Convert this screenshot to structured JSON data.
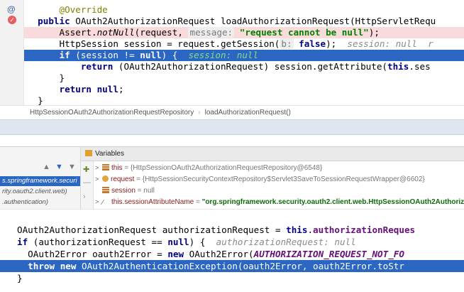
{
  "editor_top": {
    "line1": {
      "annotation": "@Override"
    },
    "line2": {
      "kw1": "public",
      "text": " OAuth2AuthorizationRequest loadAuthorizationRequest(HttpServletRequ"
    },
    "line3": {
      "call": "Assert.",
      "method": "notNull",
      "open": "(request, ",
      "hint": "message:",
      "string": "\"request cannot be null\"",
      "close": ");"
    },
    "line4": {
      "text": "HttpSession session = request.getSession(",
      "hint": "b:",
      "kw": "false",
      "close": ");",
      "inline": "  session: null  r"
    },
    "line5": {
      "kw1": "if",
      "mid": " (session != ",
      "kw2": "null",
      "close": ") {",
      "inline": "  session: null"
    },
    "line6": {
      "kw": "return",
      "text": " (OAuth2AuthorizationRequest) session.getAttribute(",
      "kw2": "this",
      "tail": ".ses"
    },
    "line7": {
      "text": "}"
    },
    "line8": {
      "kw": "return",
      "mid": " ",
      "kw2": "null",
      "close": ";"
    },
    "line9": {
      "text": "}"
    }
  },
  "breadcrumb": {
    "class_name": "HttpSessionOAuth2AuthorizationRequestRepository",
    "method_name": "loadAuthorizationRequest()",
    "sep": "›"
  },
  "debugger": {
    "variables_title": "Variables",
    "frames": [
      "s.springframework.securi",
      "rity.oauth2.client.web)",
      ".authentication)"
    ],
    "vars": [
      {
        "expander": ">",
        "name": "this",
        "value": " = {HttpSessionOAuth2AuthorizationRequestRepository@6548}"
      },
      {
        "expander": ">",
        "name": "request",
        "value": " = {HttpSessionSecurityContextRepository$Servlet3SaveToSessionRequestWrapper@6602}"
      },
      {
        "expander": "",
        "name": "session",
        "value": " = null"
      },
      {
        "expander": ">",
        "name": "this.sessionAttributeName",
        "value": " = ",
        "string": "\"org.springframework.security.oauth2.client.web.HttpSessionOAuth2Authorizatio"
      }
    ]
  },
  "editor_bottom": {
    "line1": {
      "text": "OAuth2AuthorizationRequest authorizationRequest = ",
      "kw": "this",
      "dot": ".",
      "field": "authorizationReques"
    },
    "line2": {
      "kw": "if",
      "mid": " (authorizationRequest == ",
      "kw2": "null",
      "close": ") {",
      "inline": "  authorizationRequest: null"
    },
    "line3": {
      "text": "  OAuth2Error oauth2Error = ",
      "kw": "new",
      "mid": " OAuth2Error(",
      "const": "AUTHORIZATION_REQUEST_NOT_FO"
    },
    "line4": {
      "kw1": "throw",
      "sp": " ",
      "kw2": "new",
      "text": " OAuth2AuthenticationException(oauth2Error, oauth2Error.toStr"
    },
    "line5": {
      "text": "}"
    }
  },
  "colors": {
    "selection": "#2a66c2",
    "breakpoint_line": "#fadbdb",
    "keyword": "#000080",
    "string": "#008000"
  }
}
